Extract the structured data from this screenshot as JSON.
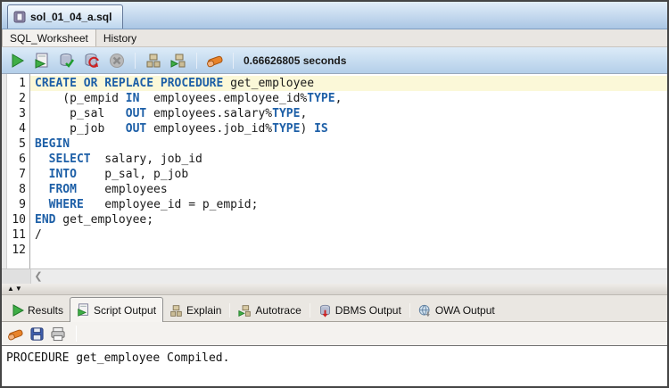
{
  "window": {
    "file_tab": "sol_01_04_a.sql"
  },
  "subtabs": {
    "worksheet": "SQL_Worksheet",
    "history": "History"
  },
  "toolbar": {
    "timer": "0.66626805 seconds"
  },
  "editor": {
    "lines": [
      {
        "n": "1",
        "hl": true,
        "seg": [
          {
            "t": "CREATE OR REPLACE PROCEDURE",
            "kw": true
          },
          {
            "t": " get_employee"
          }
        ]
      },
      {
        "n": "2",
        "seg": [
          {
            "t": "    (p_empid "
          },
          {
            "t": "IN",
            "kw": true
          },
          {
            "t": "  employees.employee_id%"
          },
          {
            "t": "TYPE",
            "kw": true
          },
          {
            "t": ","
          }
        ]
      },
      {
        "n": "3",
        "seg": [
          {
            "t": "     p_sal   "
          },
          {
            "t": "OUT",
            "kw": true
          },
          {
            "t": " employees.salary%"
          },
          {
            "t": "TYPE",
            "kw": true
          },
          {
            "t": ","
          }
        ]
      },
      {
        "n": "4",
        "seg": [
          {
            "t": "     p_job   "
          },
          {
            "t": "OUT",
            "kw": true
          },
          {
            "t": " employees.job_id%"
          },
          {
            "t": "TYPE",
            "kw": true
          },
          {
            "t": ") "
          },
          {
            "t": "IS",
            "kw": true
          }
        ]
      },
      {
        "n": "5",
        "seg": [
          {
            "t": "BEGIN",
            "kw": true
          }
        ]
      },
      {
        "n": "6",
        "seg": [
          {
            "t": "  "
          },
          {
            "t": "SELECT",
            "kw": true
          },
          {
            "t": "  salary, job_id"
          }
        ]
      },
      {
        "n": "7",
        "seg": [
          {
            "t": "  "
          },
          {
            "t": "INTO",
            "kw": true
          },
          {
            "t": "    p_sal, p_job"
          }
        ]
      },
      {
        "n": "8",
        "seg": [
          {
            "t": "  "
          },
          {
            "t": "FROM",
            "kw": true
          },
          {
            "t": "    employees"
          }
        ]
      },
      {
        "n": "9",
        "seg": [
          {
            "t": "  "
          },
          {
            "t": "WHERE",
            "kw": true
          },
          {
            "t": "   employee_id = p_empid;"
          }
        ]
      },
      {
        "n": "10",
        "seg": [
          {
            "t": "END",
            "kw": true
          },
          {
            "t": " get_employee;"
          }
        ]
      },
      {
        "n": "11",
        "seg": [
          {
            "t": "/"
          }
        ]
      },
      {
        "n": "12",
        "seg": [
          {
            "t": ""
          }
        ]
      }
    ]
  },
  "bottom_tabs": {
    "tabs": [
      {
        "label": "Results"
      },
      {
        "label": "Script Output"
      },
      {
        "label": "Explain"
      },
      {
        "label": "Autotrace"
      },
      {
        "label": "DBMS Output"
      },
      {
        "label": "OWA Output"
      }
    ]
  },
  "output": {
    "text": "PROCEDURE get_employee Compiled."
  },
  "colors": {
    "keyword_blue": "#1d5fa7",
    "line_highlight": "#fbf8d8",
    "tab_blue": "#aac6e4",
    "run_green": "#3fae46",
    "eraser_orange": "#e8832a"
  }
}
